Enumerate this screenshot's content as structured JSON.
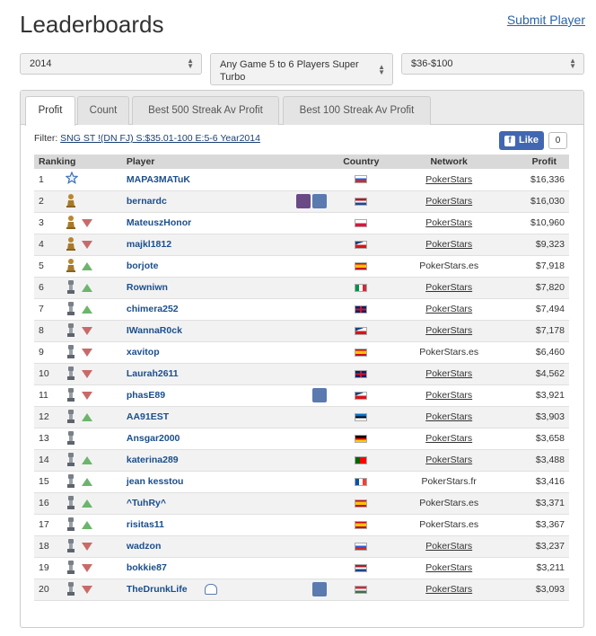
{
  "header": {
    "title": "Leaderboards",
    "submit_label": "Submit Player"
  },
  "filters": {
    "year": "2014",
    "game": "Any Game 5 to 6 Players Super Turbo",
    "buyin": "$36-$100"
  },
  "tabs": [
    "Profit",
    "Count",
    "Best 500 Streak Av Profit",
    "Best 100 Streak Av Profit"
  ],
  "active_tab": "Profit",
  "filter_label": "Filter:",
  "filter_text": "SNG ST !(DN FJ) S:$35.01-100 E:5-6 Year2014",
  "like": {
    "label": "Like",
    "count": "0"
  },
  "table": {
    "headers": {
      "ranking": "Ranking",
      "player": "Player",
      "country": "Country",
      "network": "Network",
      "profit": "Profit"
    },
    "rows": [
      {
        "rank": "1",
        "medal": "star",
        "trend": "",
        "player": "MAPA3MATuK",
        "flag": "ru",
        "network": "PokerStars",
        "link": true,
        "profit": "$16,336",
        "badges": []
      },
      {
        "rank": "2",
        "medal": "gold",
        "trend": "",
        "player": "bernardc",
        "flag": "nl",
        "network": "PokerStars",
        "link": true,
        "profit": "$16,030",
        "badges": [
          "b1",
          "b2"
        ]
      },
      {
        "rank": "3",
        "medal": "gold",
        "trend": "down",
        "player": "MateuszHonor",
        "flag": "pl",
        "network": "PokerStars",
        "link": true,
        "profit": "$10,960",
        "badges": []
      },
      {
        "rank": "4",
        "medal": "gold",
        "trend": "down",
        "player": "majkl1812",
        "flag": "cz",
        "network": "PokerStars",
        "link": true,
        "profit": "$9,323",
        "badges": []
      },
      {
        "rank": "5",
        "medal": "gold",
        "trend": "up",
        "player": "borjote",
        "flag": "es",
        "network": "PokerStars.es",
        "link": false,
        "profit": "$7,918",
        "badges": []
      },
      {
        "rank": "6",
        "medal": "silver",
        "trend": "up",
        "player": "Rowniwn",
        "flag": "it",
        "network": "PokerStars",
        "link": true,
        "profit": "$7,820",
        "badges": []
      },
      {
        "rank": "7",
        "medal": "silver",
        "trend": "up",
        "player": "chimera252",
        "flag": "gb",
        "network": "PokerStars",
        "link": true,
        "profit": "$7,494",
        "badges": []
      },
      {
        "rank": "8",
        "medal": "silver",
        "trend": "down",
        "player": "IWannaR0ck",
        "flag": "cz",
        "network": "PokerStars",
        "link": true,
        "profit": "$7,178",
        "badges": []
      },
      {
        "rank": "9",
        "medal": "silver",
        "trend": "down",
        "player": "xavitop",
        "flag": "es",
        "network": "PokerStars.es",
        "link": false,
        "profit": "$6,460",
        "badges": []
      },
      {
        "rank": "10",
        "medal": "silver",
        "trend": "down",
        "player": "Laurah2611",
        "flag": "gb",
        "network": "PokerStars",
        "link": true,
        "profit": "$4,562",
        "badges": []
      },
      {
        "rank": "11",
        "medal": "silver",
        "trend": "down",
        "player": "phasE89",
        "flag": "cz",
        "network": "PokerStars",
        "link": true,
        "profit": "$3,921",
        "badges": [
          "b2"
        ]
      },
      {
        "rank": "12",
        "medal": "silver",
        "trend": "up",
        "player": "AA91EST",
        "flag": "ee",
        "network": "PokerStars",
        "link": true,
        "profit": "$3,903",
        "badges": []
      },
      {
        "rank": "13",
        "medal": "silver",
        "trend": "",
        "player": "Ansgar2000",
        "flag": "de",
        "network": "PokerStars",
        "link": true,
        "profit": "$3,658",
        "badges": []
      },
      {
        "rank": "14",
        "medal": "silver",
        "trend": "up",
        "player": "katerina289",
        "flag": "pt",
        "network": "PokerStars",
        "link": true,
        "profit": "$3,488",
        "badges": []
      },
      {
        "rank": "15",
        "medal": "silver",
        "trend": "up",
        "player": "jean kesstou",
        "flag": "fr",
        "network": "PokerStars.fr",
        "link": false,
        "profit": "$3,416",
        "badges": []
      },
      {
        "rank": "16",
        "medal": "silver",
        "trend": "up",
        "player": "^TuhRy^",
        "flag": "es",
        "network": "PokerStars.es",
        "link": false,
        "profit": "$3,371",
        "badges": []
      },
      {
        "rank": "17",
        "medal": "silver",
        "trend": "up",
        "player": "risitas11",
        "flag": "es",
        "network": "PokerStars.es",
        "link": false,
        "profit": "$3,367",
        "badges": []
      },
      {
        "rank": "18",
        "medal": "silver",
        "trend": "down",
        "player": "wadzon",
        "flag": "ru",
        "network": "PokerStars",
        "link": true,
        "profit": "$3,237",
        "badges": []
      },
      {
        "rank": "19",
        "medal": "silver",
        "trend": "down",
        "player": "bokkie87",
        "flag": "nl",
        "network": "PokerStars",
        "link": true,
        "profit": "$3,211",
        "badges": []
      },
      {
        "rank": "20",
        "medal": "silver",
        "trend": "down",
        "player": "TheDrunkLife",
        "flag": "hu",
        "network": "PokerStars",
        "link": true,
        "profit": "$3,093",
        "badges": [
          "b3",
          "b2"
        ]
      }
    ]
  }
}
